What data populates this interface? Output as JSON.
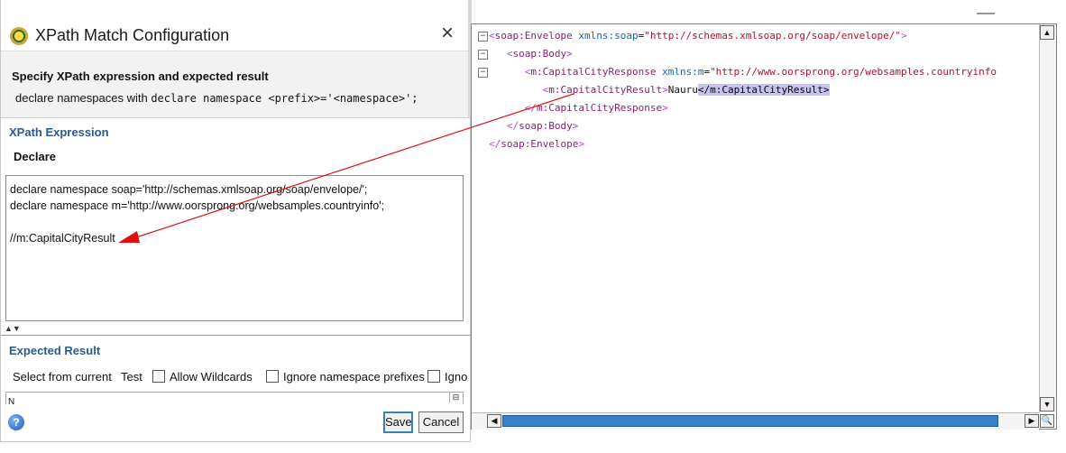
{
  "dialog": {
    "title": "XPath Match Configuration",
    "close_glyph": "×",
    "header_title": "Specify XPath expression and expected result",
    "header_sub_prefix": "declare namespaces with ",
    "header_sub_code": "declare namespace <prefix>='<namespace>';",
    "xpath_section_label": "XPath Expression",
    "declare_label": "Declare",
    "xpath_lines": [
      "declare namespace soap='http://schemas.xmlsoap.org/soap/envelope/';",
      "declare namespace m='http://www.oorsprong.org/websamples.countryinfo';",
      "",
      "//m:CapitalCityResult"
    ],
    "splitter_glyph": "▲▼",
    "expected_section_label": "Expected Result",
    "select_from_current": "Select from current",
    "test": "Test",
    "allow_wildcards": "Allow Wildcards",
    "ignore_ns_prefixes": "Ignore namespace prefixes",
    "ignore_truncated": "Igno",
    "result_value": "N",
    "help_glyph": "?",
    "save_label": "Save",
    "cancel_label": "Cancel"
  },
  "editor": {
    "lines": [
      {
        "fold": "−",
        "indent": "",
        "parts": [
          [
            "br",
            "<"
          ],
          [
            "tag",
            "soap:Envelope"
          ],
          [
            "txt",
            " "
          ],
          [
            "attrn",
            "xmlns:soap"
          ],
          [
            "txt",
            "="
          ],
          [
            "attrv",
            "\"http://schemas.xmlsoap.org/soap/envelope/\""
          ],
          [
            "br",
            ">"
          ]
        ]
      },
      {
        "fold": "−",
        "indent": "   ",
        "parts": [
          [
            "br",
            "<"
          ],
          [
            "tag",
            "soap:Body"
          ],
          [
            "br",
            ">"
          ]
        ]
      },
      {
        "fold": "−",
        "indent": "      ",
        "parts": [
          [
            "br",
            "<"
          ],
          [
            "tag",
            "m:CapitalCityResponse"
          ],
          [
            "txt",
            " "
          ],
          [
            "attrn",
            "xmlns:m"
          ],
          [
            "txt",
            "="
          ],
          [
            "attrv",
            "\"http://www.oorsprong.org/websamples.countryinfo"
          ]
        ]
      },
      {
        "fold": "",
        "indent": "         ",
        "parts": [
          [
            "br",
            "<"
          ],
          [
            "tag",
            "m:CapitalCityResult"
          ],
          [
            "br",
            ">"
          ],
          [
            "txt",
            "Nauru"
          ],
          [
            "sel",
            "</m:CapitalCityResult>"
          ]
        ]
      },
      {
        "fold": "",
        "indent": "      ",
        "parts": [
          [
            "br",
            "</"
          ],
          [
            "tag",
            "m:CapitalCityResponse"
          ],
          [
            "br",
            ">"
          ]
        ]
      },
      {
        "fold": "",
        "indent": "   ",
        "parts": [
          [
            "br",
            "</"
          ],
          [
            "tag",
            "soap:Body"
          ],
          [
            "br",
            ">"
          ]
        ]
      },
      {
        "fold": "",
        "indent": "",
        "parts": [
          [
            "br",
            "</"
          ],
          [
            "tag",
            "soap:Envelope"
          ],
          [
            "br",
            ">"
          ]
        ]
      }
    ],
    "scroll_up": "▲",
    "scroll_down": "▼",
    "scroll_left": "◀",
    "scroll_right": "▶",
    "corner_icon": "search-icon"
  },
  "colors": {
    "arrow": "#e01010",
    "section_label": "#2c5a8c",
    "selection": "#c7c3f0",
    "scroll_thumb": "#3a80c8"
  }
}
